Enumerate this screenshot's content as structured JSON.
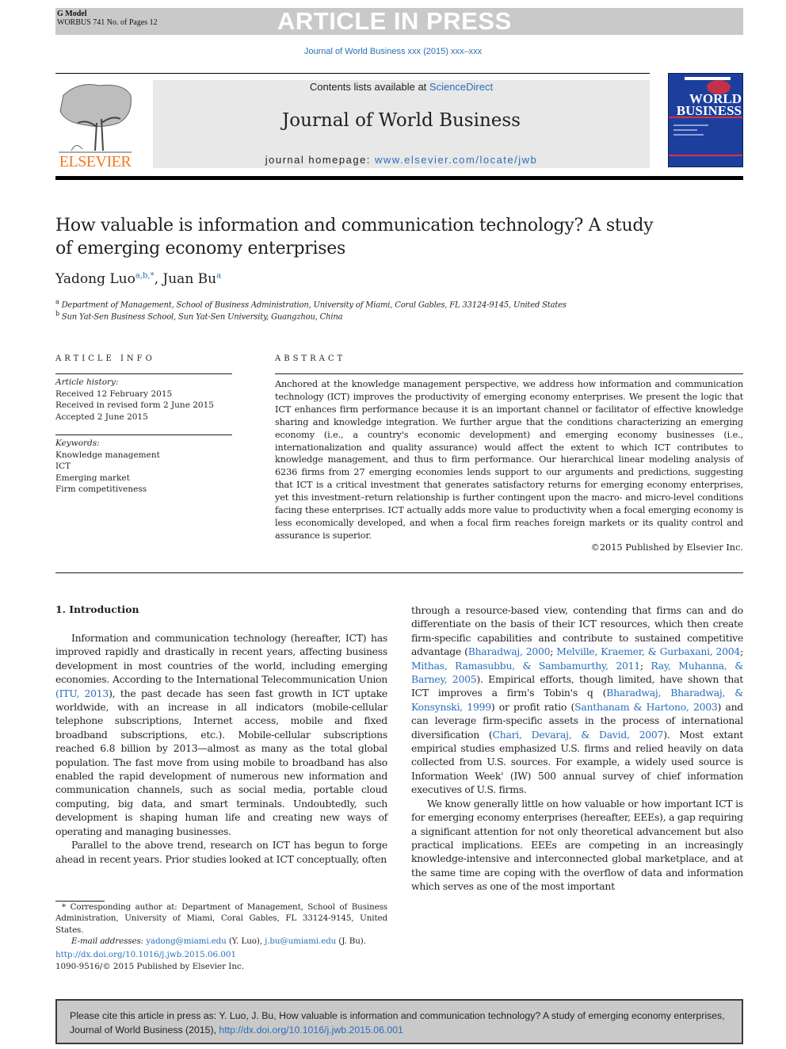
{
  "banner": {
    "model_label": "G Model",
    "model_info": "WORBUS 741 No. of Pages 12",
    "status": "ARTICLE IN PRESS"
  },
  "journal_reference": "Journal of World Business xxx (2015) xxx–xxx",
  "masthead": {
    "publisher": "ELSEVIER",
    "contents_prefix": "Contents lists available at ",
    "contents_link": "ScienceDirect",
    "journal_title": "Journal of World Business",
    "homepage_prefix": "journal homepage: ",
    "homepage_link": "www.elsevier.com/locate/jwb",
    "cover_title_line1": "WORLD",
    "cover_title_line2": "BUSINESS",
    "colors": {
      "publisher_orange": "#f47920",
      "link_blue": "#2a6ebb",
      "cover_blue": "#1c3f9e",
      "banner_gray": "#c9c9c9"
    }
  },
  "article": {
    "title": "How valuable is information and communication technology? A study of emerging economy enterprises",
    "authors": [
      {
        "name": "Yadong Luo",
        "marks": "a,b,*"
      },
      {
        "name": "Juan Bu",
        "marks": "a"
      }
    ],
    "author_separator": ", ",
    "affiliations": [
      {
        "mark": "a",
        "text": "Department of Management, School of Business Administration, University of Miami, Coral Gables, FL 33124-9145, United States"
      },
      {
        "mark": "b",
        "text": "Sun Yat-Sen Business School, Sun Yat-Sen University, Guangzhou, China"
      }
    ]
  },
  "article_info": {
    "heading": "ARTICLE INFO",
    "history_label": "Article history:",
    "history": [
      "Received 12 February 2015",
      "Received in revised form 2 June 2015",
      "Accepted 2 June 2015"
    ],
    "keywords_label": "Keywords:",
    "keywords": [
      "Knowledge management",
      "ICT",
      "Emerging market",
      "Firm competitiveness"
    ]
  },
  "abstract": {
    "heading": "ABSTRACT",
    "text": "Anchored at the knowledge management perspective, we address how information and communication technology (ICT) improves the productivity of emerging economy enterprises. We present the logic that ICT enhances firm performance because it is an important channel or facilitator of effective knowledge sharing and knowledge integration. We further argue that the conditions characterizing an emerging economy (i.e., a country's economic development) and emerging economy businesses (i.e., internationalization and quality assurance) would affect the extent to which ICT contributes to knowledge management, and thus to firm performance. Our hierarchical linear modeling analysis of 6236 firms from 27 emerging economies lends support to our arguments and predictions, suggesting that ICT is a critical investment that generates satisfactory returns for emerging economy enterprises, yet this investment–return relationship is further contingent upon the macro- and micro-level conditions facing these enterprises. ICT actually adds more value to productivity when a focal emerging economy is less economically developed, and when a focal firm reaches foreign markets or its quality control and assurance is superior.",
    "copyright": "©2015 Published by Elsevier Inc."
  },
  "body": {
    "section_heading": "1. Introduction",
    "left": {
      "p1_a": "Information and communication technology (hereafter, ICT) has improved rapidly and drastically in recent years, affecting business development in most countries of the world, including emerging economies. According to the International Telecommunication Union ",
      "p1_cite": "(ITU, 2013",
      "p1_b": "), the past decade has seen fast growth in ICT uptake worldwide, with an increase in all indicators (mobile-cellular telephone subscriptions, Internet access, mobile and fixed broadband subscriptions, etc.). Mobile-cellular subscriptions reached 6.8 billion by 2013—almost as many as the total global population. The fast move from using mobile to broadband has also enabled the rapid development of numerous new information and communication channels, such as social media, portable cloud computing, big data, and smart terminals. Undoubtedly, such development is shaping human life and creating new ways of operating and managing businesses.",
      "p2": "Parallel to the above trend, research on ICT has begun to forge ahead in recent years. Prior studies looked at ICT conceptually, often"
    },
    "right": {
      "p1_a": "through a resource-based view, contending that firms can and do differentiate on the basis of their ICT resources, which then create firm-specific capabilities and contribute to sustained competitive advantage (",
      "cite1": "Bharadwaj, 2000",
      "sep1": "; ",
      "cite2": "Melville, Kraemer, & Gurbaxani, 2004",
      "sep2": "; ",
      "cite3": "Mithas, Ramasubbu, & Sambamurthy, 2011",
      "sep3": "; ",
      "cite4": "Ray, Muhanna, & Barney, 2005",
      "p1_b": "). Empirical efforts, though limited, have shown that ICT improves a firm's Tobin's q (",
      "cite5": "Bharadwaj, Bharadwaj, & Konsynski, 1999",
      "p1_c": ") or profit ratio (",
      "cite6": "Santhanam & Hartono, 2003",
      "p1_d": ") and can leverage firm-specific assets in the process of international diversification (",
      "cite7": "Chari, Devaraj, & David, 2007",
      "p1_e": "). Most extant empirical studies emphasized U.S. firms and relied heavily on data collected from U.S. sources. For example, a widely used source is Information Week' (IW) 500 annual survey of chief information executives of U.S. firms.",
      "p2": "We know generally little on how valuable or how important ICT is for emerging economy enterprises (hereafter, EEEs), a gap requiring a significant attention for not only theoretical advancement but also practical implications. EEEs are competing in an increasingly knowledge-intensive and interconnected global marketplace, and at the same time are coping with the overflow of data and information which serves as one of the most important"
    }
  },
  "footnotes": {
    "corresponding": "* Corresponding author at: Department of Management, School of Business Administration, University of Miami, Coral Gables, FL 33124-9145, United States.",
    "email_label": "E-mail addresses: ",
    "email1": "yadong@miami.edu",
    "email1_owner": " (Y. Luo), ",
    "email2": "j.bu@umiami.edu",
    "email2_owner": " (J. Bu).",
    "doi": "http://dx.doi.org/10.1016/j.jwb.2015.06.001",
    "issn": "1090-9516/© 2015 Published by Elsevier Inc."
  },
  "cite_box": {
    "text": "Please cite this article in press as: Y. Luo, J. Bu, How valuable is information and communication technology? A study of emerging economy enterprises, Journal of World Business (2015), ",
    "link": "http://dx.doi.org/10.1016/j.jwb.2015.06.001"
  }
}
